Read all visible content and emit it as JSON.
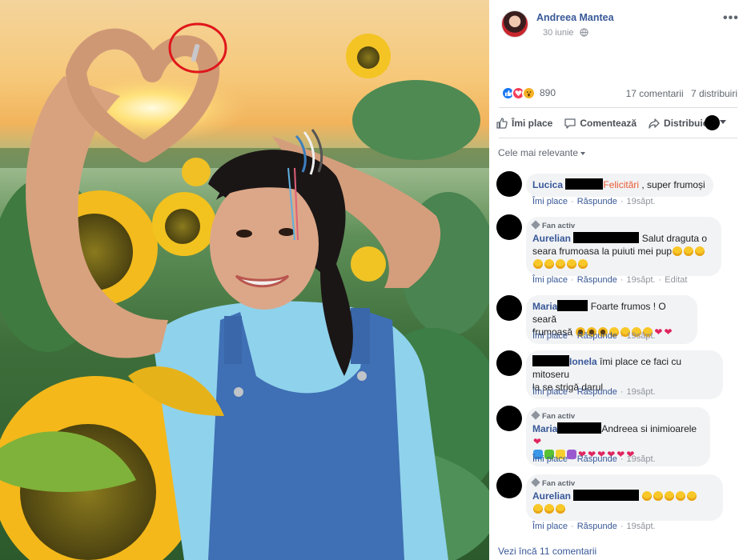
{
  "post": {
    "author": "Andreea Mantea",
    "date": "30 iunie",
    "reaction_count": "890",
    "comments_count": "17 comentarii",
    "shares_count": "7 distribuiri"
  },
  "actions": {
    "like": "Îmi place",
    "comment": "Comentează",
    "share": "Distribuie"
  },
  "filter_label": "Cele mai relevante",
  "comment_ui": {
    "like": "Îmi place",
    "reply": "Răspunde",
    "badge": "Fan activ",
    "edited": "Editat"
  },
  "comments": [
    {
      "name": "Lucica",
      "highlight": "Felicitări",
      "text": " , super frumoși",
      "time": "19săpt."
    },
    {
      "name": "Aurelian",
      "line1": "Salut draguta o",
      "line2": "seara frumoasa la puiuti mei pup",
      "time": "19săpt."
    },
    {
      "name": "Maria",
      "line1": "Foarte frumos ! O seară",
      "line2": "frumoasă",
      "time": "19săpt."
    },
    {
      "name": "Ionela",
      "line1": " îmi place ce faci cu mitoseru",
      "line2": "la se strigă darul",
      "time": "19săpt."
    },
    {
      "name": "Maria",
      "line1": "Andreea si inimioarele",
      "time": "19săpt."
    },
    {
      "name": "Aurelian",
      "time": "19săpt."
    }
  ],
  "more_comments": "Vezi încă 11 comentarii",
  "colors": {
    "link": "#385898",
    "meta": "#90949c",
    "bubble": "#f2f3f5",
    "annotation": "#e0161b"
  }
}
